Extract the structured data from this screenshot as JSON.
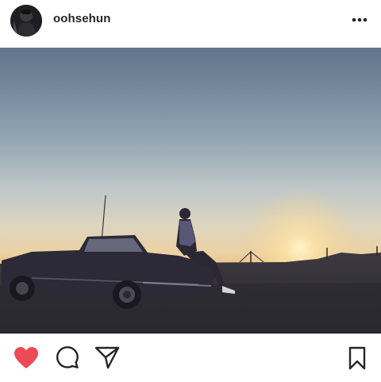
{
  "post": {
    "username": "oohsehun",
    "photo_alt": "",
    "liked": true
  },
  "colors": {
    "like_red": "#ed4956",
    "text": "#262626",
    "icon": "#262626"
  },
  "icons": {
    "avatar": "profile-avatar",
    "more": "more-options-icon",
    "like": "heart-filled-icon",
    "comment": "comment-bubble-icon",
    "share": "paper-plane-icon",
    "save": "bookmark-icon"
  }
}
